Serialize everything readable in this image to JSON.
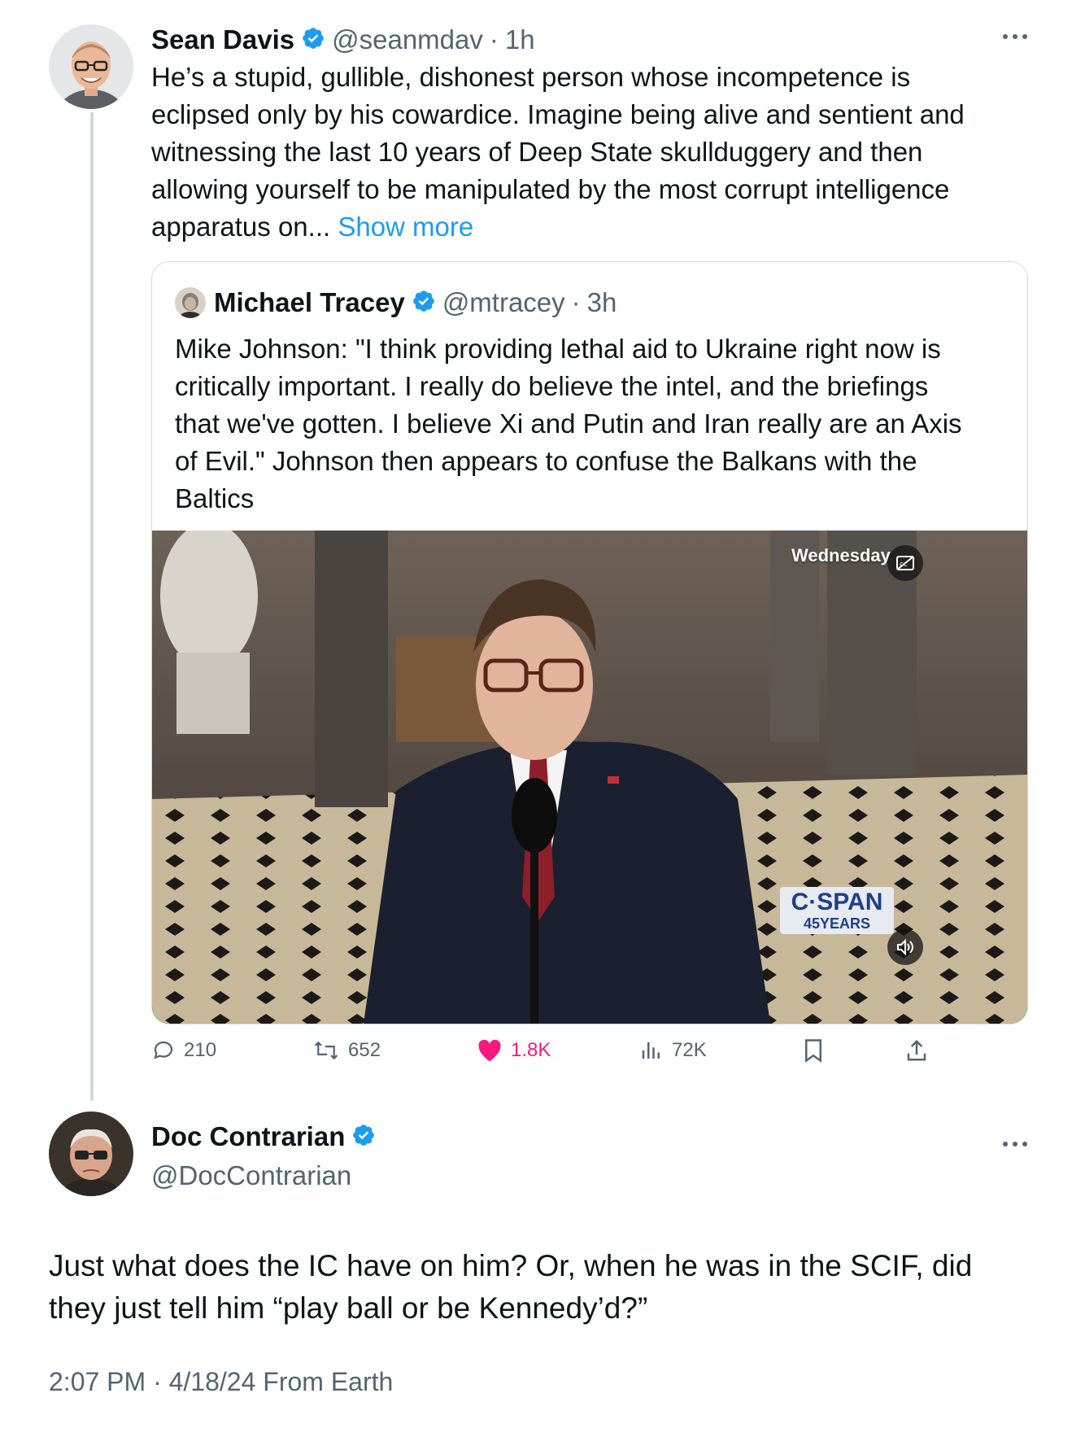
{
  "main_tweet": {
    "author_name": "Sean Davis",
    "handle": "@seanmdav",
    "separator": "·",
    "time": "1h",
    "text_lines": [
      "He’s a stupid, gullible, dishonest person whose incompetence is",
      "eclipsed only by his cowardice. Imagine being alive and sentient and",
      "witnessing the last 10 years of Deep State skullduggery and then",
      "allowing yourself to be manipulated by the most corrupt intelligence",
      "apparatus on..."
    ],
    "show_more": "Show more",
    "more_icon": "more-horizontal-icon"
  },
  "quoted_tweet": {
    "author_name": "Michael Tracey",
    "handle": "@mtracey",
    "separator": "·",
    "time": "3h",
    "text_lines": [
      "Mike Johnson: \"I think providing lethal aid to Ukraine right now is",
      "critically important. I really do believe the intel, and the briefings",
      "that we've gotten. I believe Xi and Putin and Iran really are an Axis",
      "of Evil.\" Johnson then appears to confuse the Balkans with the",
      "Baltics"
    ],
    "video": {
      "overlay_day": "Wednesday",
      "network_logo": "C·SPAN",
      "network_sub": "45YEARS",
      "icons": [
        "closed-captions-icon",
        "volume-icon"
      ]
    }
  },
  "actions": {
    "replies": "210",
    "reposts": "652",
    "likes": "1.8K",
    "views": "72K",
    "like_color": "#f91880"
  },
  "reply_tweet": {
    "author_name": "Doc Contrarian",
    "handle": "@DocContrarian",
    "text_lines": [
      "Just what does the IC have on him? Or, when he was in the SCIF, did",
      "they just tell him “play ball or be Kennedy’d?”"
    ],
    "timestamp": "2:07 PM · 4/18/24 From Earth",
    "more_icon": "more-horizontal-icon"
  },
  "colors": {
    "link": "#1d9bf0",
    "verified": "#1d9bf0",
    "secondary_text": "#536471",
    "border": "#cfd9de"
  }
}
